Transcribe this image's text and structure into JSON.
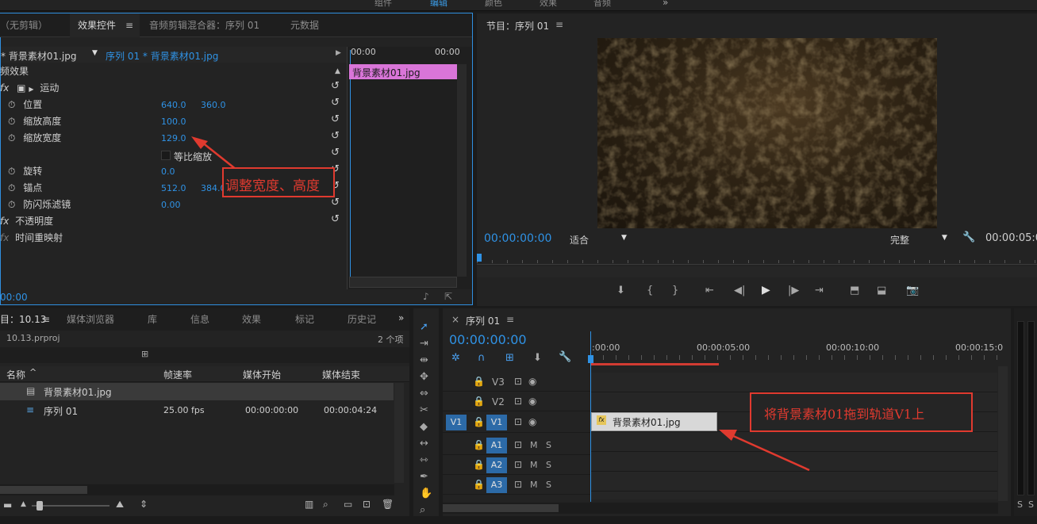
{
  "top_workspaces": [
    "组件",
    "编辑",
    "颜色",
    "效果",
    "音频"
  ],
  "source_panel": {
    "tabs": [
      "（无剪辑）",
      "效果控件",
      "音频剪辑混合器：序列 01",
      "元数据"
    ],
    "clip_master": "* 背景素材01.jpg",
    "clip_sequence": "序列 01 * 背景素材01.jpg",
    "section": "频效果",
    "motion_label": "运动",
    "props": [
      {
        "name": "位置",
        "v1": "640.0",
        "v2": "360.0"
      },
      {
        "name": "缩放高度",
        "v1": "100.0",
        "v2": ""
      },
      {
        "name": "缩放宽度",
        "v1": "129.0",
        "v2": ""
      },
      {
        "name": "等比缩放",
        "v1": "",
        "v2": ""
      },
      {
        "name": "旋转",
        "v1": "0.0",
        "v2": ""
      },
      {
        "name": "锚点",
        "v1": "512.0",
        "v2": "384.0"
      },
      {
        "name": "防闪烁滤镜",
        "v1": "0.00",
        "v2": ""
      }
    ],
    "opacity_label": "不透明度",
    "time_remap_label": "时间重映射",
    "mini_timeline": {
      "t0": "00:00",
      "t1": "00:00",
      "clip": "背景素材01.jpg"
    },
    "timecode": "00:00"
  },
  "program_monitor": {
    "title": "节目：序列 01",
    "timecode": "00:00:00:00",
    "fit": "适合",
    "quality": "完整",
    "duration": "00:00:05:0"
  },
  "project_panel": {
    "tabs": [
      "目：10.13",
      "媒体浏览器",
      "库",
      "信息",
      "效果",
      "标记",
      "历史记"
    ],
    "file": "10.13.prproj",
    "count": "2 个项",
    "columns": [
      "名称",
      "帧速率",
      "媒体开始",
      "媒体结束"
    ],
    "items": [
      {
        "name": "背景素材01.jpg",
        "fps": "",
        "start": "",
        "end": ""
      },
      {
        "name": "序列 01",
        "fps": "25.00 fps",
        "start": "00:00:00:00",
        "end": "00:00:04:24"
      }
    ]
  },
  "timeline": {
    "title": "序列 01",
    "timecode": "00:00:00:00",
    "ruler": [
      ":00:00",
      "00:00:05:00",
      "00:00:10:00",
      "00:00:15:0"
    ],
    "video_tracks": [
      "V3",
      "V2",
      "V1"
    ],
    "audio_tracks": [
      "A1",
      "A2",
      "A3"
    ],
    "source_patch": "V1",
    "clip": "背景素材01.jpg",
    "mute": "M",
    "solo": "S"
  },
  "annotations": {
    "scale": "调整宽度、高度",
    "drag": "将背景素材01拖到轨道V1上"
  },
  "meter": {
    "left": "S",
    "right": "S"
  }
}
